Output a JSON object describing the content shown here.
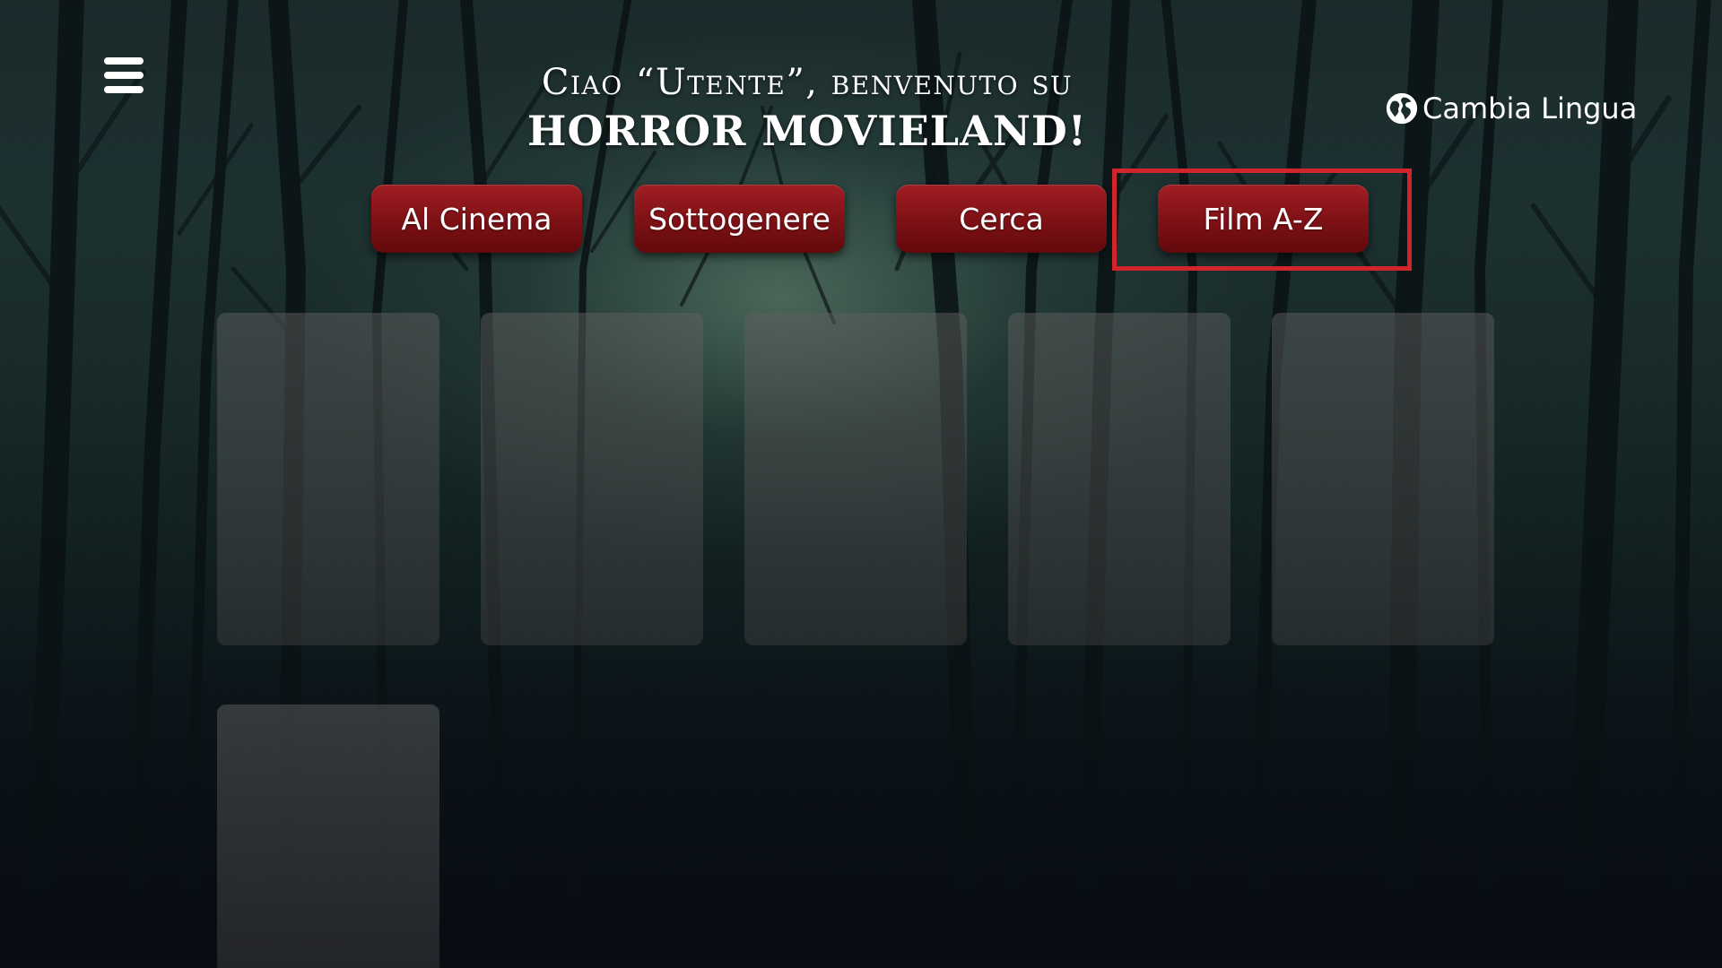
{
  "menu": {
    "icon": "hamburger-menu-icon"
  },
  "header": {
    "greeting": "Ciao “Utente”, benvenuto su",
    "app_name": "HORROR MOVIELAND!"
  },
  "language": {
    "icon": "globe-icon",
    "label": "Cambia Lingua"
  },
  "nav": {
    "buttons": [
      {
        "label": "Al Cinema"
      },
      {
        "label": "Sottogenere"
      },
      {
        "label": "Cerca"
      },
      {
        "label": "Film A-Z",
        "highlighted": true
      }
    ]
  },
  "colors": {
    "button_red": "#8a151a",
    "highlight_border": "#d0262b",
    "text": "#ffffff",
    "background_dark": "#0b1318"
  }
}
